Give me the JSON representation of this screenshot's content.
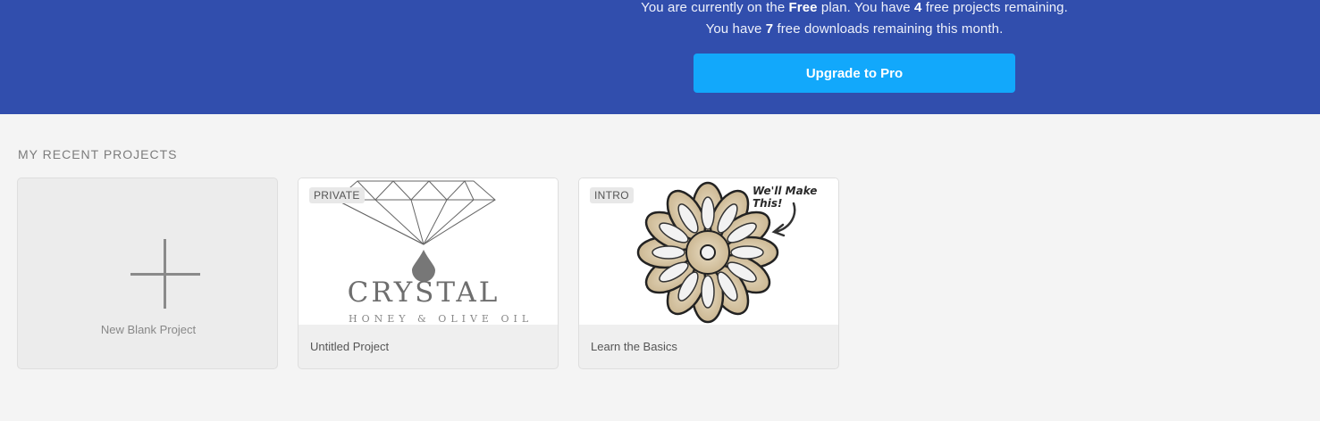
{
  "banner": {
    "line1_prefix": "You are currently on the ",
    "plan_name": "Free",
    "line1_middle": " plan. You have ",
    "projects_remaining": "4",
    "line1_suffix": " free projects remaining.",
    "line2_prefix": "You have ",
    "downloads_remaining": "7",
    "line2_suffix": " free downloads remaining this month.",
    "upgrade_label": "Upgrade to Pro"
  },
  "recent": {
    "title": "MY RECENT PROJECTS",
    "new_blank_label": "New Blank Project",
    "projects": [
      {
        "badge": "PRIVATE",
        "title": "Untitled Project",
        "logo_word": "CRYSTAL",
        "logo_sub": "HONEY & OLIVE OIL"
      },
      {
        "badge": "INTRO",
        "title": "Learn the Basics",
        "callout": "We'll Make This!"
      }
    ]
  },
  "colors": {
    "banner": "#314ead",
    "upgrade_button": "#12a8fb",
    "page_bg": "#f4f4f4"
  }
}
